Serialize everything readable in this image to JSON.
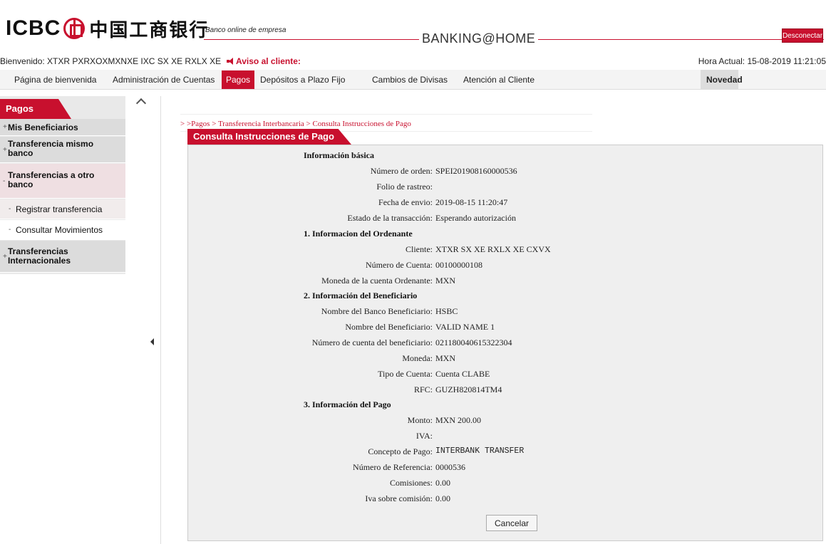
{
  "header": {
    "logo_text": "ICBC",
    "logo_cn": "中国工商银行",
    "tagline": "Banco online de empresa",
    "title": "BANKING@HOME",
    "disconnect_label": "Desconectar"
  },
  "welcome": {
    "text": "Bienvenido: XTXR PXRXOXMXNXE IXC SX XE RXLX XE",
    "notice": "Aviso al cliente:",
    "clock": "Hora Actual: 15-08-2019 11:21:05"
  },
  "nav": {
    "items": [
      {
        "label": "Página de bienvenida"
      },
      {
        "label": "Administración de Cuentas"
      },
      {
        "label": "Pagos"
      },
      {
        "label": "Depósitos a Plazo Fijo"
      },
      {
        "label": "Cambios de Divisas"
      },
      {
        "label": "Atención al Cliente"
      }
    ],
    "news_label": "Novedad"
  },
  "sidebar": {
    "title": "Pagos",
    "items": [
      {
        "label": "Mis Beneficiarios",
        "sign": "+"
      },
      {
        "label": "Transferencia mismo banco",
        "sign": "+"
      },
      {
        "label": "Transferencias a otro banco",
        "sign": "-"
      },
      {
        "label": "Registrar transferencia",
        "sign": "-"
      },
      {
        "label": "Consultar Movimientos",
        "sign": "-"
      },
      {
        "label": "Transferencias Internacionales",
        "sign": "+"
      }
    ]
  },
  "breadcrumb": "> >Pagos > Transferencia Interbancaria > Consulta Instrucciones de Pago",
  "panel": {
    "title": "Consulta Instrucciones de Pago",
    "sections": {
      "basic": "Información básica",
      "ordering": "1. Informacion del Ordenante",
      "beneficiary": "2. Información del Beneficiario",
      "payment": "3. Información del Pago"
    },
    "fields": [
      {
        "label": "Número de orden:",
        "value": "SPEI201908160000536"
      },
      {
        "label": "Folio de rastreo:",
        "value": ""
      },
      {
        "label": "Fecha de envio:",
        "value": "2019-08-15 11:20:47"
      },
      {
        "label": "Estado de la transacción:",
        "value": "Esperando autorización"
      },
      {
        "label": "Cliente:",
        "value": "XTXR SX XE RXLX XE CXVX"
      },
      {
        "label": "Número de Cuenta:",
        "value": "00100000108"
      },
      {
        "label": "Moneda de la cuenta Ordenante:",
        "value": "MXN"
      },
      {
        "label": "Nombre del Banco Beneficiario:",
        "value": "HSBC"
      },
      {
        "label": "Nombre del Beneficiario:",
        "value": "VALID NAME 1"
      },
      {
        "label": "Número de cuenta del beneficiario:",
        "value": "021180040615322304"
      },
      {
        "label": "Moneda:",
        "value": "MXN"
      },
      {
        "label": "Tipo de Cuenta:",
        "value": "Cuenta CLABE"
      },
      {
        "label": "RFC:",
        "value": "GUZH820814TM4"
      },
      {
        "label": "Monto:",
        "value": "MXN 200.00"
      },
      {
        "label": "IVA:",
        "value": ""
      },
      {
        "label": "Concepto de Pago:",
        "value": "INTERBANK TRANSFER"
      },
      {
        "label": "Número de Referencia:",
        "value": "0000536"
      },
      {
        "label": "Comisiones:",
        "value": "0.00"
      },
      {
        "label": "Iva sobre comisión:",
        "value": "0.00"
      }
    ],
    "cancel_label": "Cancelar"
  },
  "colors": {
    "accent": "#c8102e"
  }
}
